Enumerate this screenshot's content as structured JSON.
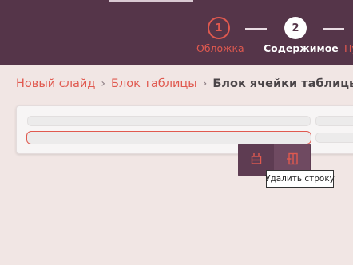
{
  "steps": [
    {
      "number": "1",
      "label": "Обложка",
      "state": "done"
    },
    {
      "number": "2",
      "label": "Содержимое",
      "state": "active"
    },
    {
      "label": "Пу",
      "state": "next"
    }
  ],
  "breadcrumb": {
    "items": [
      "Новый слайд",
      "Блок таблицы"
    ],
    "current": "Блок ячейки таблицы"
  },
  "toolbar": {
    "buttons": [
      {
        "icon": "insert-row-icon"
      },
      {
        "icon": "delete-row-icon"
      }
    ],
    "tooltip": "Удалить строку"
  },
  "colors": {
    "header_bg": "#553549",
    "accent": "#e0594f",
    "page_bg": "#f1e6e4"
  }
}
